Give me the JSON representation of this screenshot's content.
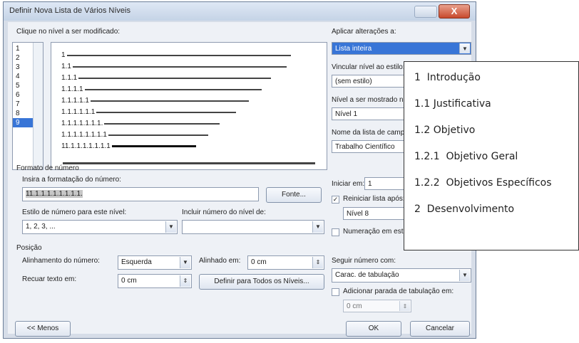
{
  "window": {
    "title": "Definir Nova Lista de Vários Níveis",
    "close_label": "X"
  },
  "level_pick": {
    "label": "Clique no nível a ser modificado:",
    "levels": [
      "1",
      "2",
      "3",
      "4",
      "5",
      "6",
      "7",
      "8",
      "9"
    ],
    "selected_index": 8
  },
  "preview": {
    "rows": [
      "1",
      "1.1",
      "1.1.1",
      "1.1.1.1",
      "1.1.1.1.1",
      "1.1.1.1.1.1",
      "1.1.1.1.1.1.1.",
      "1.1.1.1.1.1.1.1",
      "11.1.1.1.1.1.1.1"
    ]
  },
  "apply": {
    "label": "Aplicar alterações a:",
    "value": "Lista inteira"
  },
  "link_style": {
    "label": "Vincular nível ao estilo:",
    "value": "(sem estilo)"
  },
  "gallery_level": {
    "label": "Nível a ser mostrado na",
    "value": "Nível 1"
  },
  "listnum_name": {
    "label": "Nome da lista de campo",
    "value": "Trabalho Científico"
  },
  "number_format": {
    "section": "Formato de número",
    "format_label": "Insira a formatação do número:",
    "format_value": "11.1.1.1.1.1.1.1.1.",
    "font_button": "Fonte...",
    "style_label": "Estilo de número para este nível:",
    "style_value": "1, 2, 3, ...",
    "include_label": "Incluir número do nível de:",
    "include_value": ""
  },
  "start": {
    "label": "Iniciar em:",
    "value": "1"
  },
  "restart": {
    "label": "Reiniciar lista após:",
    "value": "Nível 8",
    "checked": "✓"
  },
  "legal": {
    "label": "Numeração em estilo"
  },
  "position": {
    "section": "Posição",
    "align_label": "Alinhamento do número:",
    "align_value": "Esquerda",
    "aligned_at_label": "Alinhado em:",
    "aligned_at_value": "0 cm",
    "indent_label": "Recuar texto em:",
    "indent_value": "0 cm",
    "set_all_button": "Definir para Todos os Níveis...",
    "follow_label": "Seguir número com:",
    "follow_value": "Carac. de tabulação",
    "add_tab_label": "Adicionar parada de tabulação em:",
    "add_tab_value": "0 cm"
  },
  "footer": {
    "less_button": "<< Menos",
    "ok_button": "OK",
    "cancel_button": "Cancelar"
  },
  "overlay": {
    "items": [
      "1  Introdução",
      "1.1 Justificativa",
      "1.2 Objetivo",
      "1.2.1  Objetivo Geral",
      "1.2.2  Objetivos Específicos",
      "2  Desenvolvimento"
    ]
  }
}
